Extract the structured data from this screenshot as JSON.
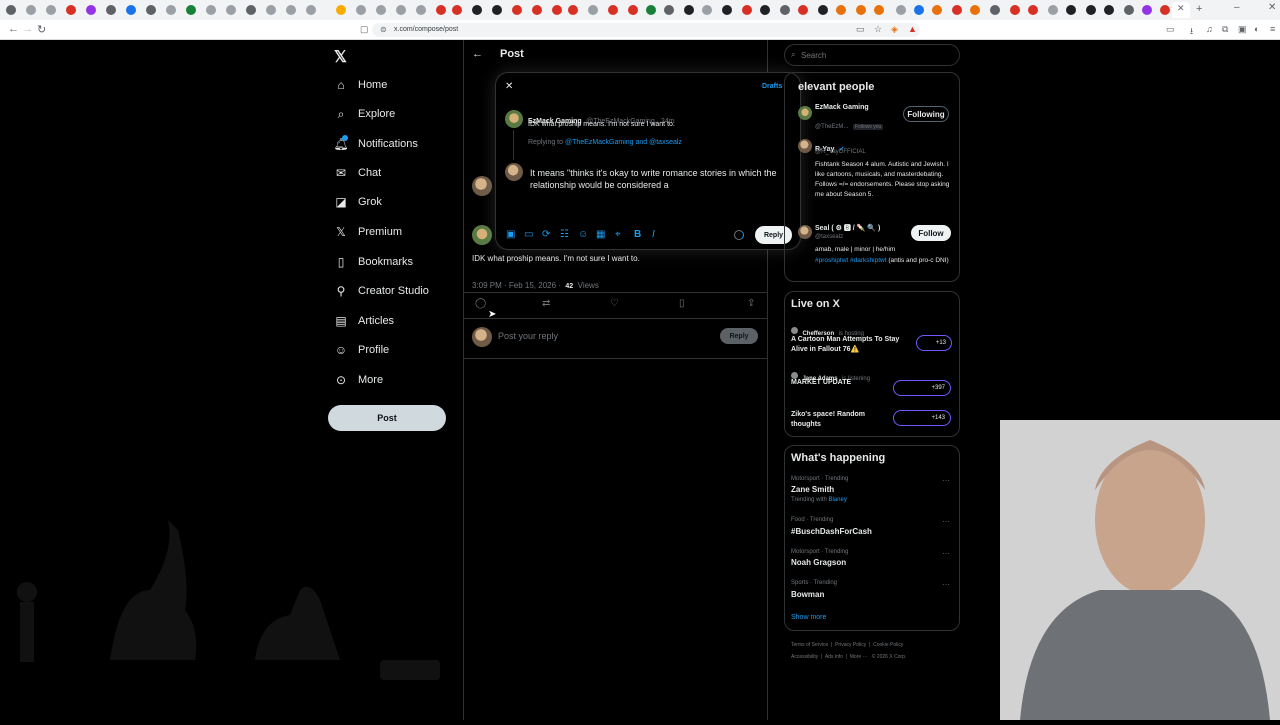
{
  "browser": {
    "url": "x.com/compose/post"
  },
  "sidebar": {
    "items": [
      {
        "label": "Home",
        "icon": "home-icon"
      },
      {
        "label": "Explore",
        "icon": "search-icon"
      },
      {
        "label": "Notifications",
        "icon": "bell-icon"
      },
      {
        "label": "Chat",
        "icon": "mail-icon"
      },
      {
        "label": "Grok",
        "icon": "grok-icon"
      },
      {
        "label": "Premium",
        "icon": "x-logo-icon"
      },
      {
        "label": "Bookmarks",
        "icon": "bookmark-icon"
      },
      {
        "label": "Creator Studio",
        "icon": "creator-icon"
      },
      {
        "label": "Articles",
        "icon": "articles-icon"
      },
      {
        "label": "Profile",
        "icon": "person-icon"
      },
      {
        "label": "More",
        "icon": "more-icon"
      }
    ],
    "post_button": "Post"
  },
  "main": {
    "header_title": "Post",
    "tweet_text": "IDK what proship means. I'm not sure I want to.",
    "tweet_time": "3:09 PM · Feb 15, 2026 ·",
    "tweet_views": "42",
    "tweet_views_label": "Views",
    "reply_placeholder": "Post your reply",
    "reply_button": "Reply"
  },
  "modal": {
    "drafts": "Drafts",
    "orig_name": "EzMack Gaming",
    "orig_handle": "@TheEzMackGaming · 24m",
    "orig_text": "IDK what proship means. I'm not sure I want to.",
    "replying_to_label": "Replying to",
    "replying_to_users": "@TheEzMackGaming and @taxsealz",
    "compose_text": "It means \"thinks it's okay to write romance stories in which the relationship would be considered a",
    "reply_button": "Reply"
  },
  "right": {
    "search_placeholder": "Search",
    "relevant": {
      "title": "elevant people",
      "people": [
        {
          "name": "EzMack Gaming",
          "handle": "@TheEzM...",
          "follows_you": "Follows you",
          "button": "Following",
          "bio": ""
        },
        {
          "name": "R-Yay",
          "handle": "@R_YayOFFICIAL",
          "bio": "Fishtank Season 4 alum. Autistic and Jewish. I like cartoons, musicals, and masterdebating. Follows =/= endorsements. Please stop asking me about Season 5.",
          "button": ""
        },
        {
          "name": "Seal ( ⚙ 🅱 / 🍡 🔍 )",
          "handle": "@taxsealz",
          "bio": "amab, male | minor | he/him",
          "bio_tags": "#proshiptwt #darkshiptwt",
          "bio_tail": "(antis and pro-c DNI)",
          "button": "Follow"
        }
      ]
    },
    "live": {
      "title": "Live on X",
      "items": [
        {
          "host": "Chefferson",
          "status": "is hosting",
          "title": "A Cartoon Man Attempts To Stay Alive in Fallout 76⚠️",
          "count": "+13"
        },
        {
          "host": "Jane Adams",
          "status": "is listening",
          "title": "MARKET UPDATE",
          "count": "+397"
        },
        {
          "host": "",
          "status": "",
          "title": "Ziko's space! Random thoughts",
          "count": "+143"
        }
      ]
    },
    "happening": {
      "title": "What's happening",
      "trends": [
        {
          "meta": "Motorsport · Trending",
          "name": "Zane Smith",
          "extra": "Trending with",
          "extra_link": "Blaney"
        },
        {
          "meta": "Food · Trending",
          "name": "#BuschDashForCash",
          "extra": "",
          "extra_link": ""
        },
        {
          "meta": "Motorsport · Trending",
          "name": "Noah Gragson",
          "extra": "",
          "extra_link": ""
        },
        {
          "meta": "Sports · Trending",
          "name": "Bowman",
          "extra": "",
          "extra_link": ""
        }
      ],
      "show_more": "Show more"
    },
    "footer": {
      "line1": [
        "Terms of Service",
        "Privacy Policy",
        "Cookie Policy"
      ],
      "line2": [
        "Accessibility",
        "Ads info",
        "More ···",
        "© 2026 X Corp."
      ]
    }
  },
  "colors": {
    "accent": "#1d9bf0",
    "bg": "#000000",
    "border": "#2f3336",
    "muted": "#71767b",
    "spaces_purple": "#7856ff"
  }
}
